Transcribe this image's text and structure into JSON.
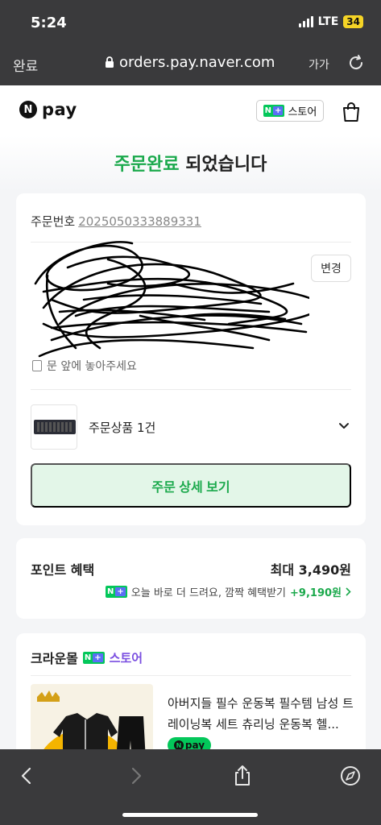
{
  "status_bar": {
    "time": "5:24",
    "network": "LTE",
    "battery": "34"
  },
  "browser": {
    "done_label": "완료",
    "url": "orders.pay.naver.com",
    "text_size_label": "가가"
  },
  "header": {
    "logo_n": "N",
    "logo_text": "pay",
    "store_badge": "N+",
    "store_label": "스토어"
  },
  "title": {
    "highlight": "주문완료",
    "rest": " 되었습니다"
  },
  "order": {
    "number_label": "주문번호",
    "number": "2025050333889331",
    "change_button": "변경",
    "delivery_memo": "문 앞에 놓아주세요",
    "product_summary": "주문상품 1건",
    "detail_button": "주문 상세 보기"
  },
  "points": {
    "title": "포인트 혜택",
    "max": "최대 3,490원",
    "badge": "N+",
    "subtext": "오늘 바로 더 드려요, 깜짝 혜택받기",
    "bonus": "+9,190원"
  },
  "shop": {
    "name": "크라운몰",
    "badge": "N+",
    "store_label": "스토어",
    "product_desc": "아버지들 필수 운동복 필수템 남성 트레이닝복 세트 츄리닝 운동복 헬...",
    "pay_tag": "pay"
  }
}
